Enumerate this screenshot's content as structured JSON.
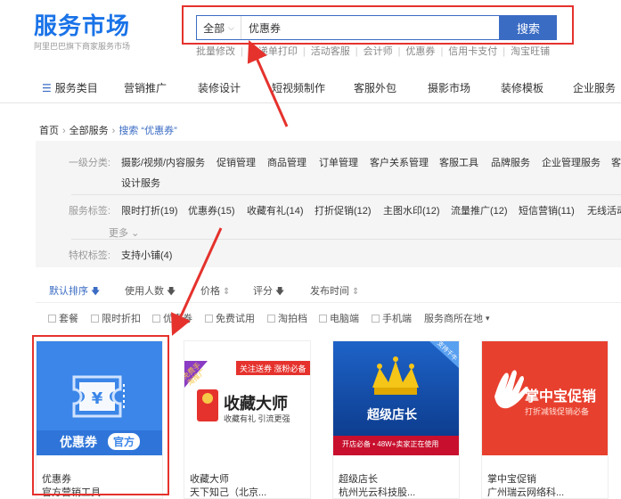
{
  "header": {
    "logo_text": "服务市场",
    "logo_sub": "阿里巴巴旗下商家服务市场"
  },
  "search": {
    "category": "全部",
    "value": "优惠券",
    "button": "搜索"
  },
  "hot_links": [
    "批量修改",
    "快递单打印",
    "活动客服",
    "会计师",
    "优惠券",
    "信用卡支付",
    "淘宝旺铺"
  ],
  "nav": {
    "menu": "服务类目",
    "items": [
      "营销推广",
      "装修设计",
      "短视频制作",
      "客服外包",
      "摄影市场",
      "装修模板",
      "企业服务"
    ]
  },
  "breadcrumb": {
    "home": "首页",
    "all": "全部服务",
    "search": "搜索 “优惠券”"
  },
  "filters": {
    "level1": {
      "label": "一级分类:",
      "items": [
        "摄影/视频/内容服务",
        "促销管理",
        "商品管理",
        "订单管理",
        "客户关系管理",
        "客服工具",
        "品牌服务",
        "企业管理服务",
        "客",
        "设计服务"
      ]
    },
    "tags": {
      "label": "服务标签:",
      "items": [
        "限时打折(19)",
        "优惠券(15)",
        "收藏有礼(14)",
        "打折促销(12)",
        "主图水印(12)",
        "流量推广(12)",
        "短信营销(11)",
        "无线活动"
      ],
      "more": "更多"
    },
    "privilege": {
      "label": "特权标签:",
      "items": [
        "支持小铺(4)"
      ]
    }
  },
  "sort": {
    "items": [
      "默认排序",
      "使用人数",
      "价格",
      "评分",
      "发布时间"
    ]
  },
  "checks": [
    "套餐",
    "限时折扣",
    "优惠券",
    "免费试用",
    "淘拍档",
    "电脑端",
    "手机端"
  ],
  "location": "服务商所在地",
  "cards": [
    {
      "name": "优惠券",
      "sub": "官方营销工具",
      "img_text": "优惠券",
      "img_badge": "官方"
    },
    {
      "name": "收藏大师",
      "sub": "天下知己（北京...",
      "img_title": "收藏大师",
      "img_sub": "收藏有礼 引流更强",
      "img_tag": "关注送券 涨粉必备",
      "img_ribbon": "免费手淘推广"
    },
    {
      "name": "超级店长",
      "sub": "杭州光云科技股...",
      "img_title": "超级店长",
      "img_bottom": "开店必备 • 48W+卖家正在使用",
      "img_corner": "支持千牛"
    },
    {
      "name": "掌中宝促销",
      "sub": "广州瑞云网络科...",
      "img_title": "掌中宝促销",
      "img_sub": "打折减钱促销必备"
    }
  ],
  "colors": {
    "brand": "#3b6cc4",
    "highlight": "#e5322d"
  }
}
